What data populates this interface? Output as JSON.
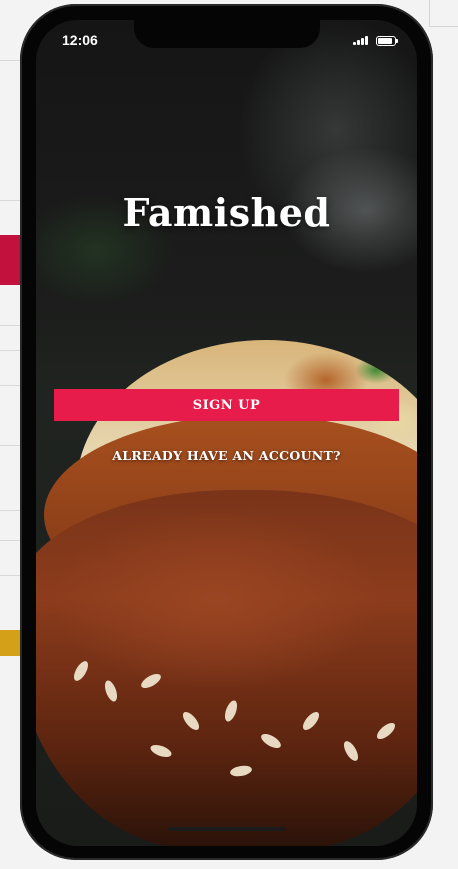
{
  "status_bar": {
    "time": "12:06"
  },
  "app": {
    "title": "Famished"
  },
  "actions": {
    "signup_label": "SIGN UP",
    "login_link_label": "ALREADY HAVE AN ACCOUNT?"
  },
  "colors": {
    "primary_button": "#e81c4a",
    "text": "#ffffff"
  }
}
